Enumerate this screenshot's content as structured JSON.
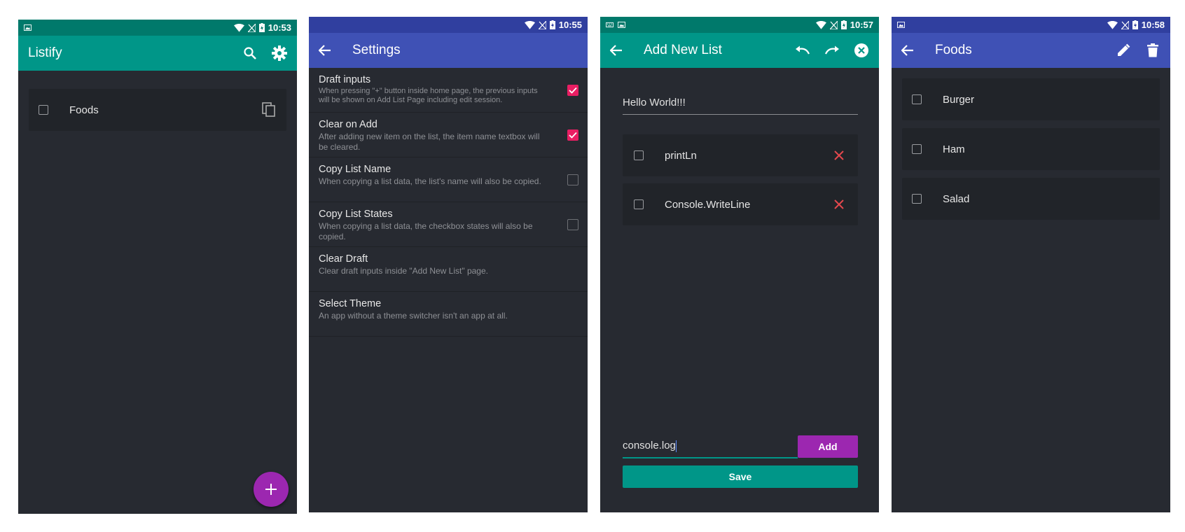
{
  "colors": {
    "teal": "#009688",
    "teal_dark": "#00796b",
    "indigo": "#3f51b5",
    "indigo_dark": "#303f9f",
    "pink": "#e91e63",
    "purple": "#9c27b0",
    "background": "#272a31",
    "card": "#212429",
    "delete_red": "#e5484d"
  },
  "screens": [
    {
      "name": "home",
      "status_time": "10:53",
      "title": "Listify",
      "actions": [
        "search-icon",
        "gear-icon"
      ],
      "lists": [
        {
          "label": "Foods",
          "checked": false,
          "action_icon": "copy-icon"
        }
      ],
      "fab_icon": "plus-icon"
    },
    {
      "name": "settings",
      "status_time": "10:55",
      "title": "Settings",
      "items": [
        {
          "title": "Draft inputs",
          "desc": "When pressing \"+\" button inside home page, the previous inputs will be shown on Add List Page including edit session.",
          "checked": true
        },
        {
          "title": "Clear on Add",
          "desc": "After adding new item on the list, the item name textbox will be cleared.",
          "checked": true
        },
        {
          "title": "Copy List Name",
          "desc": "When copying a list data, the list's name will also be copied.",
          "checked": false
        },
        {
          "title": "Copy List States",
          "desc": "When copying a list data, the checkbox states will also be copied.",
          "checked": false
        },
        {
          "title": "Clear Draft",
          "desc": "Clear draft inputs inside \"Add New List\" page."
        },
        {
          "title": "Select Theme",
          "desc": "An app without a theme switcher isn't an app at all."
        }
      ]
    },
    {
      "name": "add-new-list",
      "status_time": "10:57",
      "title": "Add New List",
      "list_name": "Hello World!!!",
      "items": [
        {
          "label": "printLn",
          "checked": false
        },
        {
          "label": "Console.WriteLine",
          "checked": false
        }
      ],
      "new_item_value": "console.log",
      "add_label": "Add",
      "save_label": "Save"
    },
    {
      "name": "list-detail",
      "status_time": "10:58",
      "title": "Foods",
      "items": [
        {
          "label": "Burger",
          "checked": false
        },
        {
          "label": "Ham",
          "checked": false
        },
        {
          "label": "Salad",
          "checked": false
        }
      ]
    }
  ]
}
